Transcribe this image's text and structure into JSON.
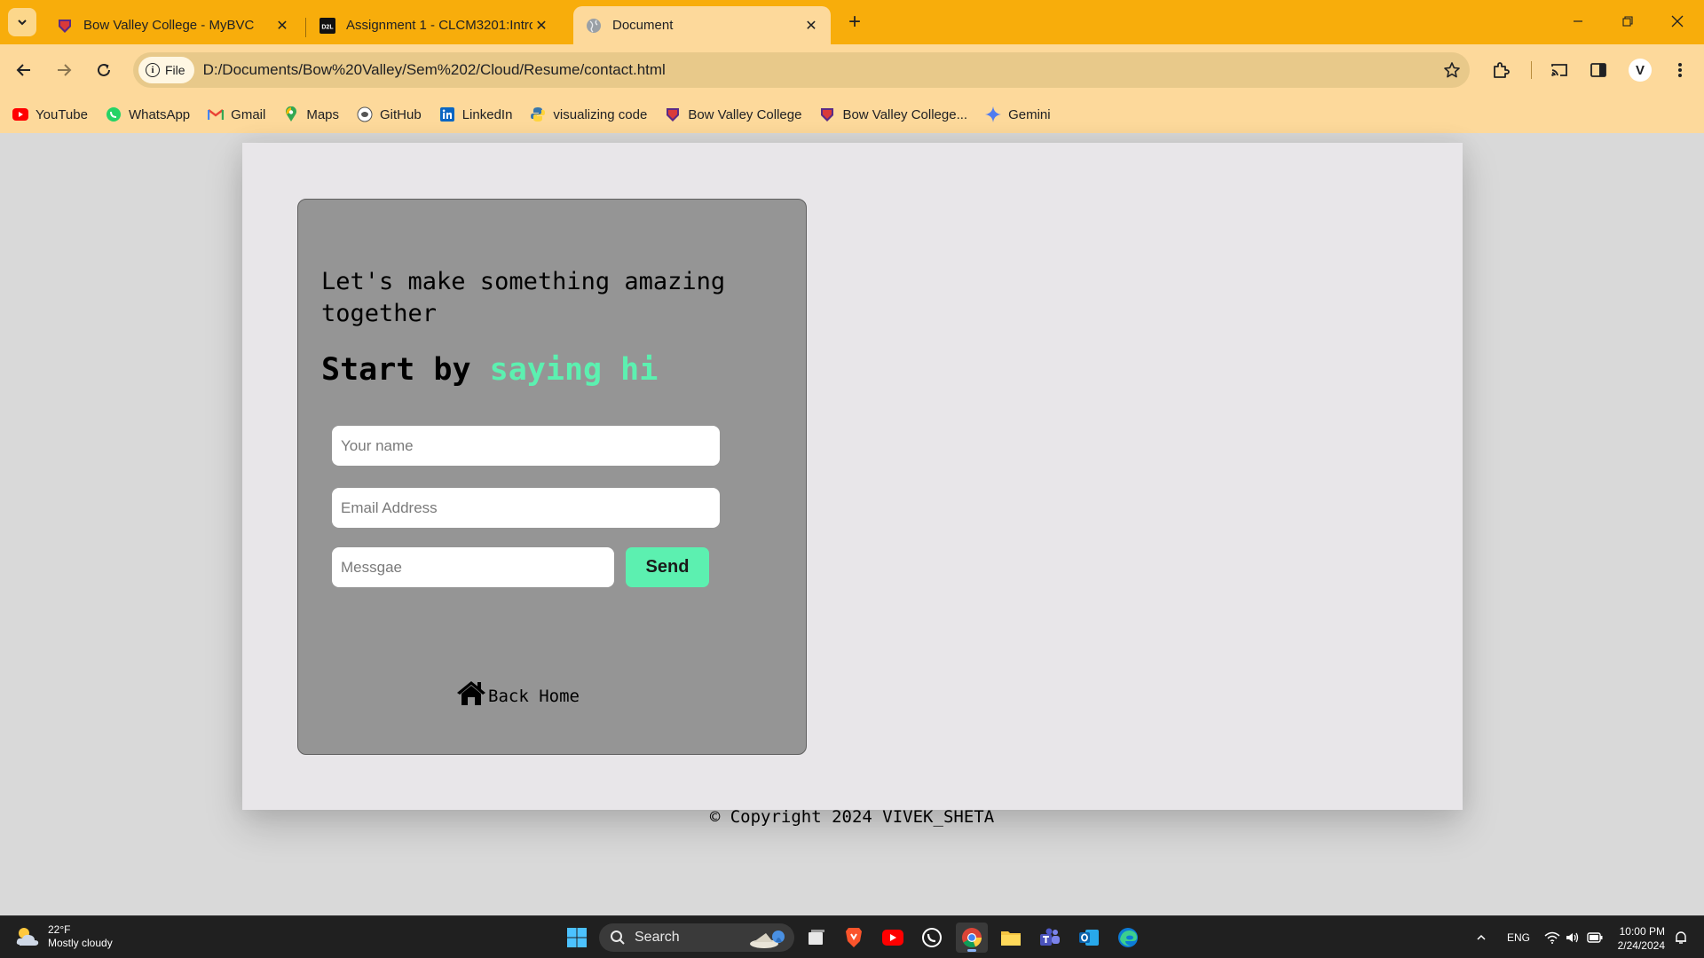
{
  "browser": {
    "tabs": [
      {
        "title": "Bow Valley College - MyBVC",
        "active": false,
        "favicon": "bow-valley-icon"
      },
      {
        "title": "Assignment 1 - CLCM3201:Intro",
        "active": false,
        "favicon": "d2l-icon"
      },
      {
        "title": "Document",
        "active": true,
        "favicon": "globe-icon"
      }
    ],
    "address": {
      "chip_label": "File",
      "url": "D:/Documents/Bow%20Valley/Sem%202/Cloud/Resume/contact.html"
    },
    "profile_initial": "V",
    "bookmarks": [
      {
        "label": "YouTube",
        "icon": "youtube-icon"
      },
      {
        "label": "WhatsApp",
        "icon": "whatsapp-icon"
      },
      {
        "label": "Gmail",
        "icon": "gmail-icon"
      },
      {
        "label": "Maps",
        "icon": "maps-icon"
      },
      {
        "label": "GitHub",
        "icon": "github-icon"
      },
      {
        "label": "LinkedIn",
        "icon": "linkedin-icon"
      },
      {
        "label": "visualizing code",
        "icon": "python-icon"
      },
      {
        "label": "Bow Valley College",
        "icon": "bow-valley-icon"
      },
      {
        "label": "Bow Valley College...",
        "icon": "bow-valley-icon"
      },
      {
        "label": "Gemini",
        "icon": "gemini-icon"
      }
    ],
    "theme_color": "#f8ad0b"
  },
  "page": {
    "headline": "Let's make something amazing together",
    "subhead_prefix": "Start by ",
    "subhead_accent": "saying hi",
    "accent_color": "#5cf0b0",
    "form": {
      "name_placeholder": "Your name",
      "email_placeholder": "Email Address",
      "message_placeholder": "Messgae",
      "send_label": "Send"
    },
    "back_home_label": "Back Home",
    "copyright": "© Copyright 2024 VIVEK_SHETA"
  },
  "taskbar": {
    "weather_temp": "22°F",
    "weather_desc": "Mostly cloudy",
    "search_label": "Search",
    "language": "ENG",
    "time": "10:00 PM",
    "date": "2/24/2024"
  }
}
